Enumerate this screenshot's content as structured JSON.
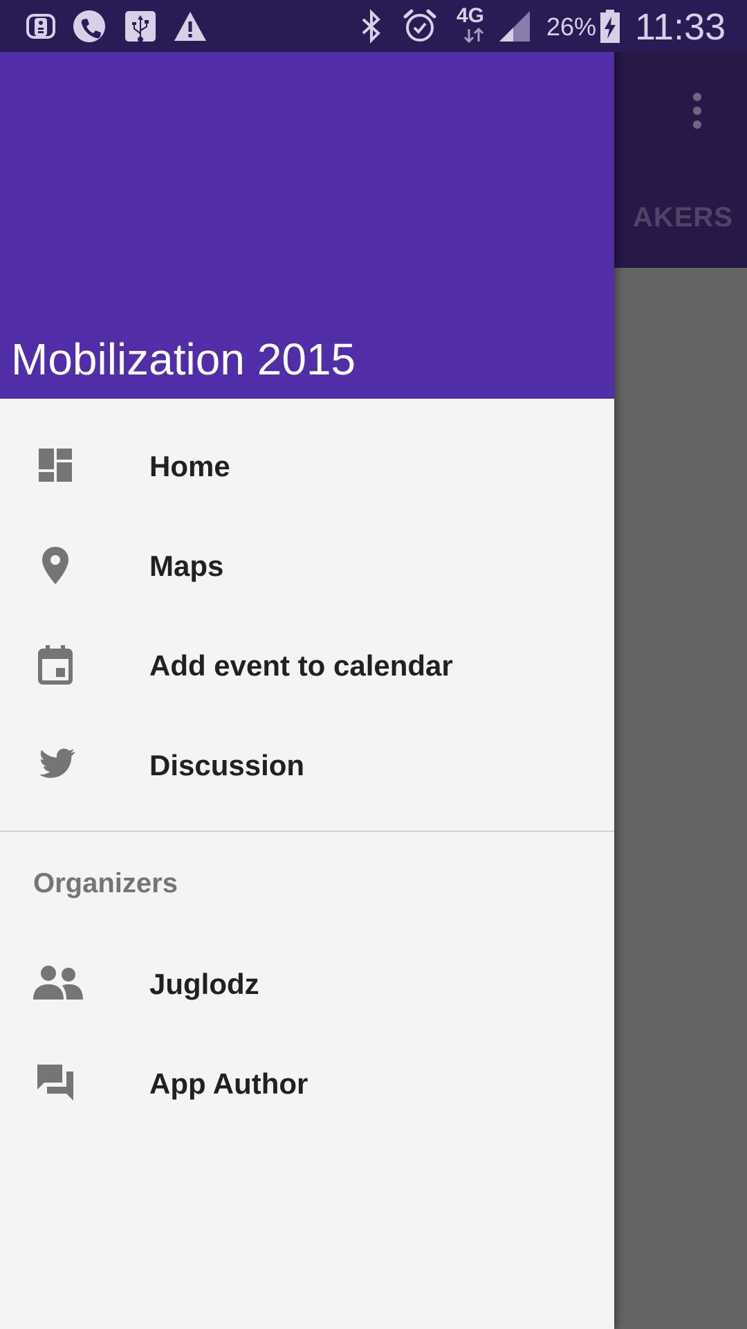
{
  "status_bar": {
    "icons": [
      "remote-icon",
      "phone-call-icon",
      "usb-icon",
      "warning-icon",
      "bluetooth-icon",
      "alarm-icon",
      "network-4g-icon",
      "signal-icon",
      "battery-charging-icon"
    ],
    "network_type": "4G",
    "battery_percent": "26%",
    "time": "11:33"
  },
  "background_app": {
    "tab_label_partial": "AKERS",
    "menu_icon": "more-vert-icon",
    "toolbar_color": "#271848",
    "scrim_color": "#646464"
  },
  "drawer": {
    "header_title": "Mobilization 2015",
    "header_color": "#512da8",
    "items": [
      {
        "label": "Home",
        "icon": "dashboard-icon"
      },
      {
        "label": "Maps",
        "icon": "map-pin-icon"
      },
      {
        "label": "Add event to calendar",
        "icon": "calendar-event-icon"
      },
      {
        "label": "Discussion",
        "icon": "twitter-bird-icon"
      }
    ],
    "section_header": "Organizers",
    "section_items": [
      {
        "label": "Juglodz",
        "icon": "people-icon"
      },
      {
        "label": "App Author",
        "icon": "forum-icon"
      }
    ]
  }
}
